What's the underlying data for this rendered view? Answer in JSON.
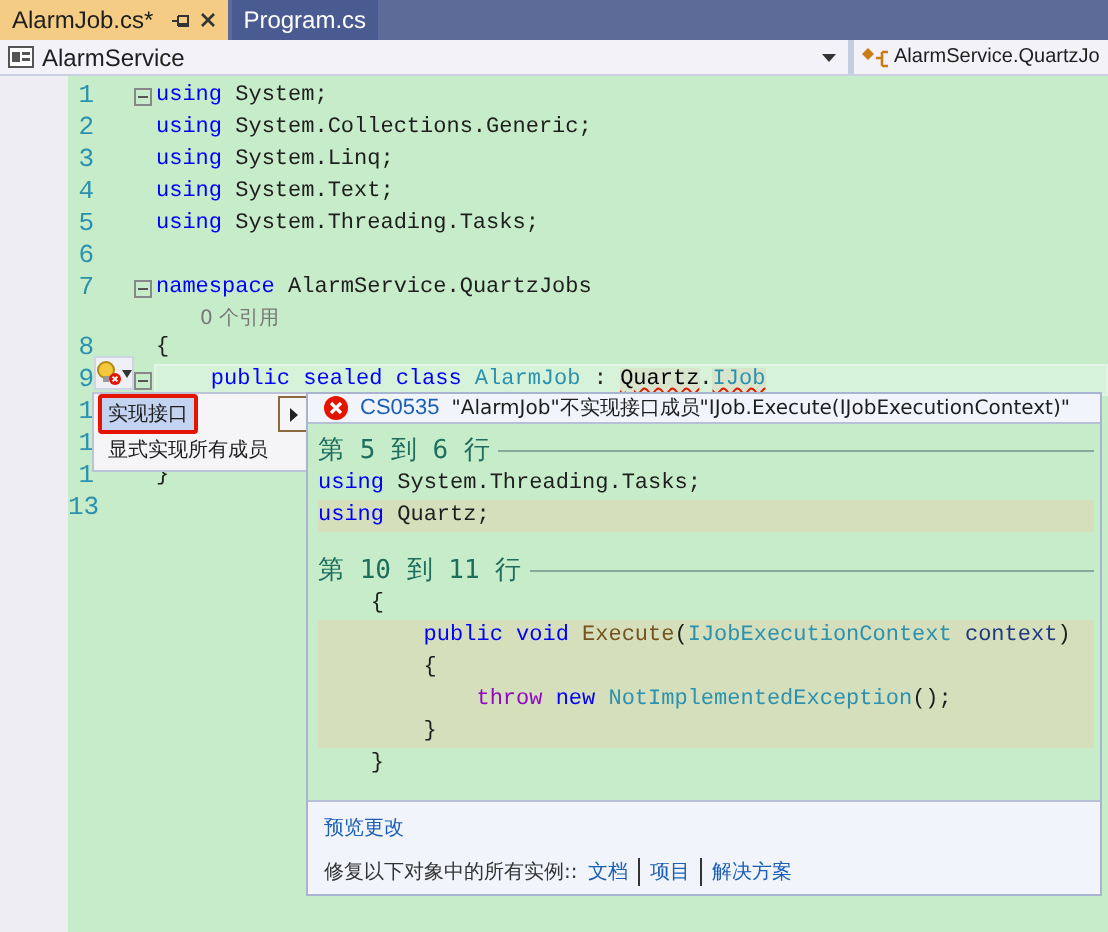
{
  "tabs": [
    {
      "label": "AlarmJob.cs*",
      "selected": true
    },
    {
      "label": "Program.cs",
      "selected": false
    }
  ],
  "nav": {
    "project": "AlarmService",
    "scope": "AlarmService.QuartzJo"
  },
  "lines": [
    {
      "number": "1",
      "fold": true,
      "current": false,
      "tokens": [
        {
          "kind": "kw",
          "text": "using"
        },
        {
          "kind": "plain",
          "text": " System;"
        }
      ]
    },
    {
      "number": "2",
      "fold": false,
      "current": false,
      "tokens": [
        {
          "kind": "kw",
          "text": "using"
        },
        {
          "kind": "plain",
          "text": " System.Collections.Generic;"
        }
      ]
    },
    {
      "number": "3",
      "fold": false,
      "current": false,
      "tokens": [
        {
          "kind": "kw",
          "text": "using"
        },
        {
          "kind": "plain",
          "text": " System.Linq;"
        }
      ]
    },
    {
      "number": "4",
      "fold": false,
      "current": false,
      "tokens": [
        {
          "kind": "kw",
          "text": "using"
        },
        {
          "kind": "plain",
          "text": " System.Text;"
        }
      ]
    },
    {
      "number": "5",
      "fold": false,
      "current": false,
      "tokens": [
        {
          "kind": "kw",
          "text": "using"
        },
        {
          "kind": "plain",
          "text": " System.Threading.Tasks;"
        }
      ]
    },
    {
      "number": "6",
      "fold": false,
      "current": false
    },
    {
      "number": "7",
      "fold": true,
      "current": false,
      "tokens": [
        {
          "kind": "kw",
          "text": "namespace"
        },
        {
          "kind": "plain",
          "text": " AlarmService.QuartzJobs"
        }
      ]
    },
    {
      "number": "8",
      "fold": false,
      "current": false,
      "codelens": "0 个引用",
      "tokens": [
        {
          "kind": "plain",
          "text": "{"
        }
      ]
    },
    {
      "number": "9",
      "fold": true,
      "current": true,
      "tokens": [
        {
          "kind": "kw",
          "text": "    public sealed class"
        },
        {
          "kind": "type",
          "text": " AlarmJob"
        },
        {
          "kind": "plain",
          "text": " : "
        },
        {
          "kind": "error",
          "text": "Quartz"
        },
        {
          "kind": "plain",
          "text": "."
        },
        {
          "kind": "errtype",
          "text": "IJob"
        }
      ]
    },
    {
      "number": "1",
      "current": false
    },
    {
      "number": "1",
      "current": false
    },
    {
      "number": "1",
      "fold": false,
      "current": false,
      "tokens": [
        {
          "kind": "plain",
          "text": "}"
        }
      ]
    },
    {
      "number": "13",
      "fold": false,
      "current": false
    }
  ],
  "fix_menu": {
    "items": [
      {
        "label": "实现接口",
        "selected": true
      },
      {
        "label": "显式实现所有成员",
        "selected": false
      }
    ]
  },
  "preview": {
    "code": "CS0535",
    "message": "\"AlarmJob\"不实现接口成员\"IJob.Execute(IJobExecutionContext)\"",
    "sections": [
      {
        "heading": "第 5 到 6 行",
        "lines": [
          {
            "added": false,
            "tokens": [
              {
                "kind": "kw",
                "text": "using"
              },
              {
                "kind": "plain",
                "text": " System.Threading.Tasks;"
              }
            ]
          },
          {
            "added": true,
            "tokens": [
              {
                "kind": "kw",
                "text": "using"
              },
              {
                "kind": "plain",
                "text": " Quartz;"
              }
            ]
          }
        ]
      },
      {
        "heading": "第 10 到 11 行",
        "lines": [
          {
            "added": false,
            "tokens": [
              {
                "kind": "plain",
                "text": "    {"
              }
            ]
          },
          {
            "added": true,
            "tokens": [
              {
                "kind": "kw",
                "text": "        public void"
              },
              {
                "kind": "method",
                "text": " Execute"
              },
              {
                "kind": "plain",
                "text": "("
              },
              {
                "kind": "type",
                "text": "IJobExecutionContext"
              },
              {
                "kind": "param",
                "text": " context"
              },
              {
                "kind": "plain",
                "text": ")"
              }
            ]
          },
          {
            "added": true,
            "tokens": [
              {
                "kind": "plain",
                "text": "        {"
              }
            ]
          },
          {
            "added": true,
            "tokens": [
              {
                "kind": "ctrl",
                "text": "            throw"
              },
              {
                "kind": "kw",
                "text": " new"
              },
              {
                "kind": "type",
                "text": " NotImplementedException"
              },
              {
                "kind": "plain",
                "text": "();"
              }
            ]
          },
          {
            "added": true,
            "tokens": [
              {
                "kind": "plain",
                "text": "        }"
              }
            ]
          },
          {
            "added": false,
            "tokens": [
              {
                "kind": "plain",
                "text": "    }"
              }
            ]
          }
        ]
      }
    ]
  },
  "preview_link": "预览更改",
  "fix_all": {
    "label": "修复以下对象中的所有实例::",
    "scopes": [
      "文档",
      "项目",
      "解决方案"
    ]
  }
}
